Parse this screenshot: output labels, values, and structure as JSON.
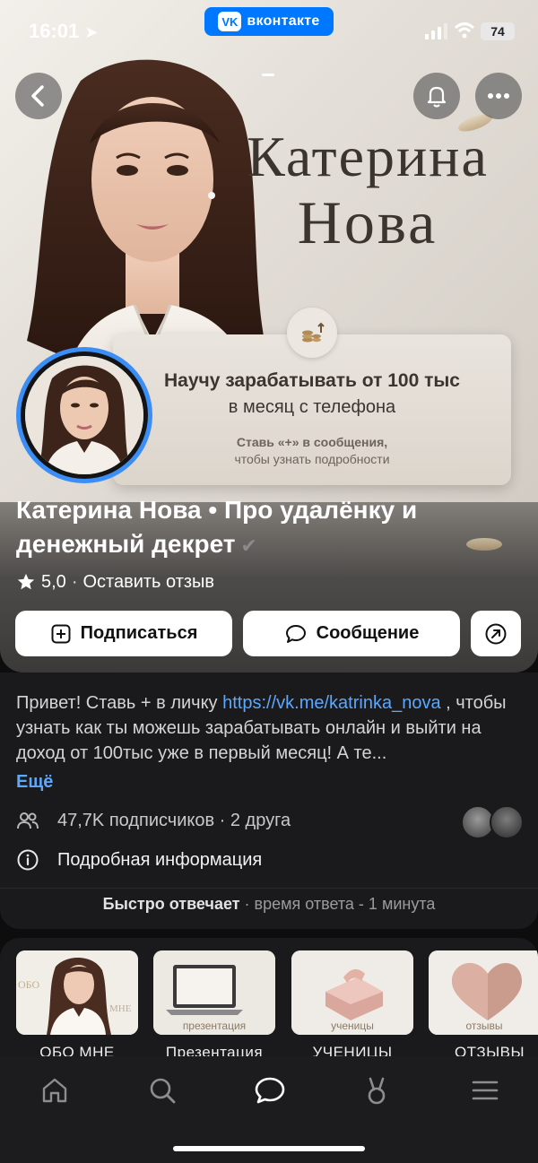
{
  "status_bar": {
    "time": "16:01",
    "app_badge": "вконтакте",
    "battery": "74"
  },
  "cover": {
    "title_line1": "Катерина",
    "title_line2": "Нова",
    "promo_line1": "Научу зарабатывать от 100 тыс",
    "promo_line2": "в месяц с телефона",
    "promo_line3": "Ставь «+» в сообщения,",
    "promo_line4": "чтобы узнать подробности"
  },
  "profile": {
    "name": "Катерина Нова • Про удалёнку и денежный декрет",
    "rating": "5,0",
    "review_link": "Оставить отзыв"
  },
  "actions": {
    "subscribe": "Подписаться",
    "message": "Сообщение"
  },
  "about": {
    "text_before": "Привет! Ставь + в личку ",
    "link": "https://vk.me/katrinka_nova",
    "text_after": " , чтобы узнать как ты можешь зарабатывать онлайн и выйти на доход от 100тыс уже в первый месяц!  А те...",
    "more": "Ещё",
    "followers": "47,7K подписчиков · 2 друга",
    "details": "Подробная информация",
    "fast_reply": "Быстро отвечает",
    "reply_time": " · время ответа - 1 минута"
  },
  "highlights": [
    {
      "label": "ОБО МНЕ",
      "cover_text": "ОБО"
    },
    {
      "label": "Презентация",
      "cover_text": "презентация"
    },
    {
      "label": "УЧЕНИЦЫ",
      "cover_text": "ученицы"
    },
    {
      "label": "ОТЗЫВЫ",
      "cover_text": "отзывы"
    }
  ],
  "tabs": [
    "home-icon",
    "search-icon",
    "messages-icon",
    "clips-icon",
    "menu-icon"
  ],
  "colors": {
    "accent": "#0077ff",
    "link": "#5aa8ff",
    "background": "#0d0d0e",
    "avatar_ring": "#3a8ef6"
  }
}
